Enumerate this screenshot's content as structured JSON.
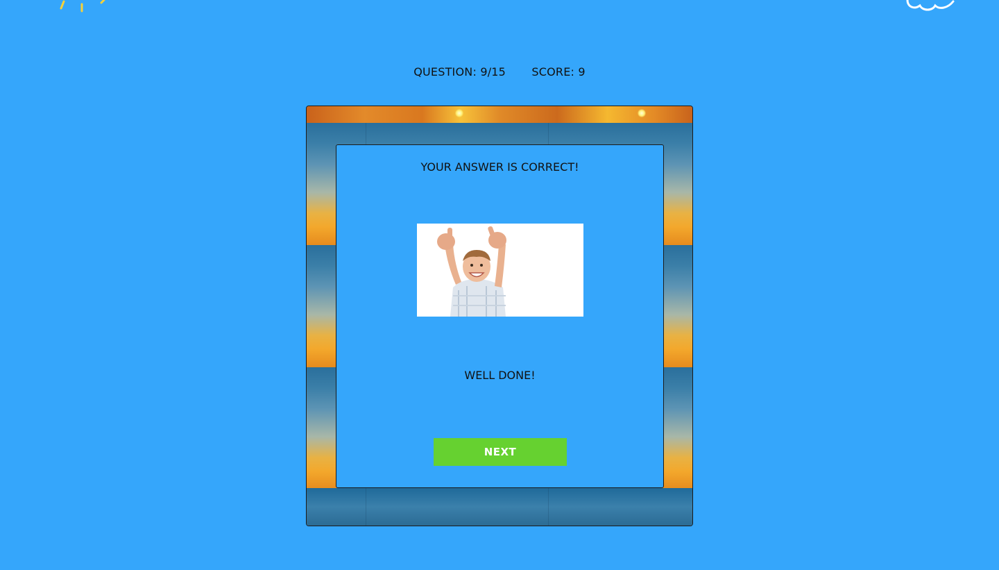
{
  "status": {
    "question_label": "QUESTION: 9/15",
    "score_label": "SCORE: 9"
  },
  "result": {
    "title": "YOUR ANSWER IS CORRECT!",
    "message": "WELL DONE!",
    "next_label": "NEXT"
  },
  "icons": {
    "top_left": "sun-icon",
    "top_right": "cloud-icon",
    "image": "thumbs-up-child-illustration"
  },
  "colors": {
    "background": "#35a6fb",
    "button": "#66d130",
    "button_text": "#ffffff",
    "text": "#111111"
  }
}
